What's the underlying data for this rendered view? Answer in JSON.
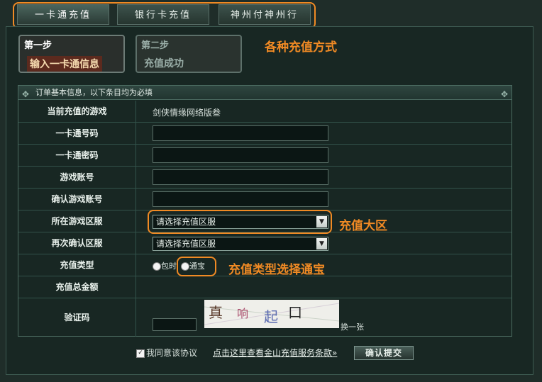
{
  "tabs": [
    "一卡通充值",
    "银行卡充值",
    "神州付神州行"
  ],
  "steps": {
    "step1": {
      "head": "第一步",
      "body": "输入一卡通信息"
    },
    "step2": {
      "head": "第二步",
      "body": "充值成功"
    }
  },
  "annotations": {
    "methods": "各种充值方式",
    "region": "充值大区",
    "type": "充值类型选择通宝"
  },
  "form": {
    "header": "订单基本信息，以下条目均为必填",
    "rows": {
      "game": {
        "label": "当前充值的游戏",
        "value": "剑侠情缘网络版叁"
      },
      "card_no": {
        "label": "一卡通号码"
      },
      "card_pwd": {
        "label": "一卡通密码"
      },
      "account": {
        "label": "游戏账号"
      },
      "account_confirm": {
        "label": "确认游戏账号"
      },
      "region": {
        "label": "所在游戏区服",
        "value": "请选择充值区服"
      },
      "region_confirm": {
        "label": "再次确认区服",
        "value": "请选择充值区服"
      },
      "type": {
        "label": "充值类型",
        "option1": "包时",
        "option2": "通宝"
      },
      "total": {
        "label": "充值总金额"
      },
      "captcha": {
        "label": "验证码",
        "chars": [
          "真",
          "响",
          "起",
          "口"
        ],
        "refresh": "换一张"
      }
    }
  },
  "footer": {
    "agree": "我同意该协议",
    "terms_link": "点击这里查看金山充值服务条款»",
    "submit": "确认提交"
  },
  "colors": {
    "accent": "#f08a24",
    "panel": "#182723",
    "background": "#1f2d29"
  }
}
